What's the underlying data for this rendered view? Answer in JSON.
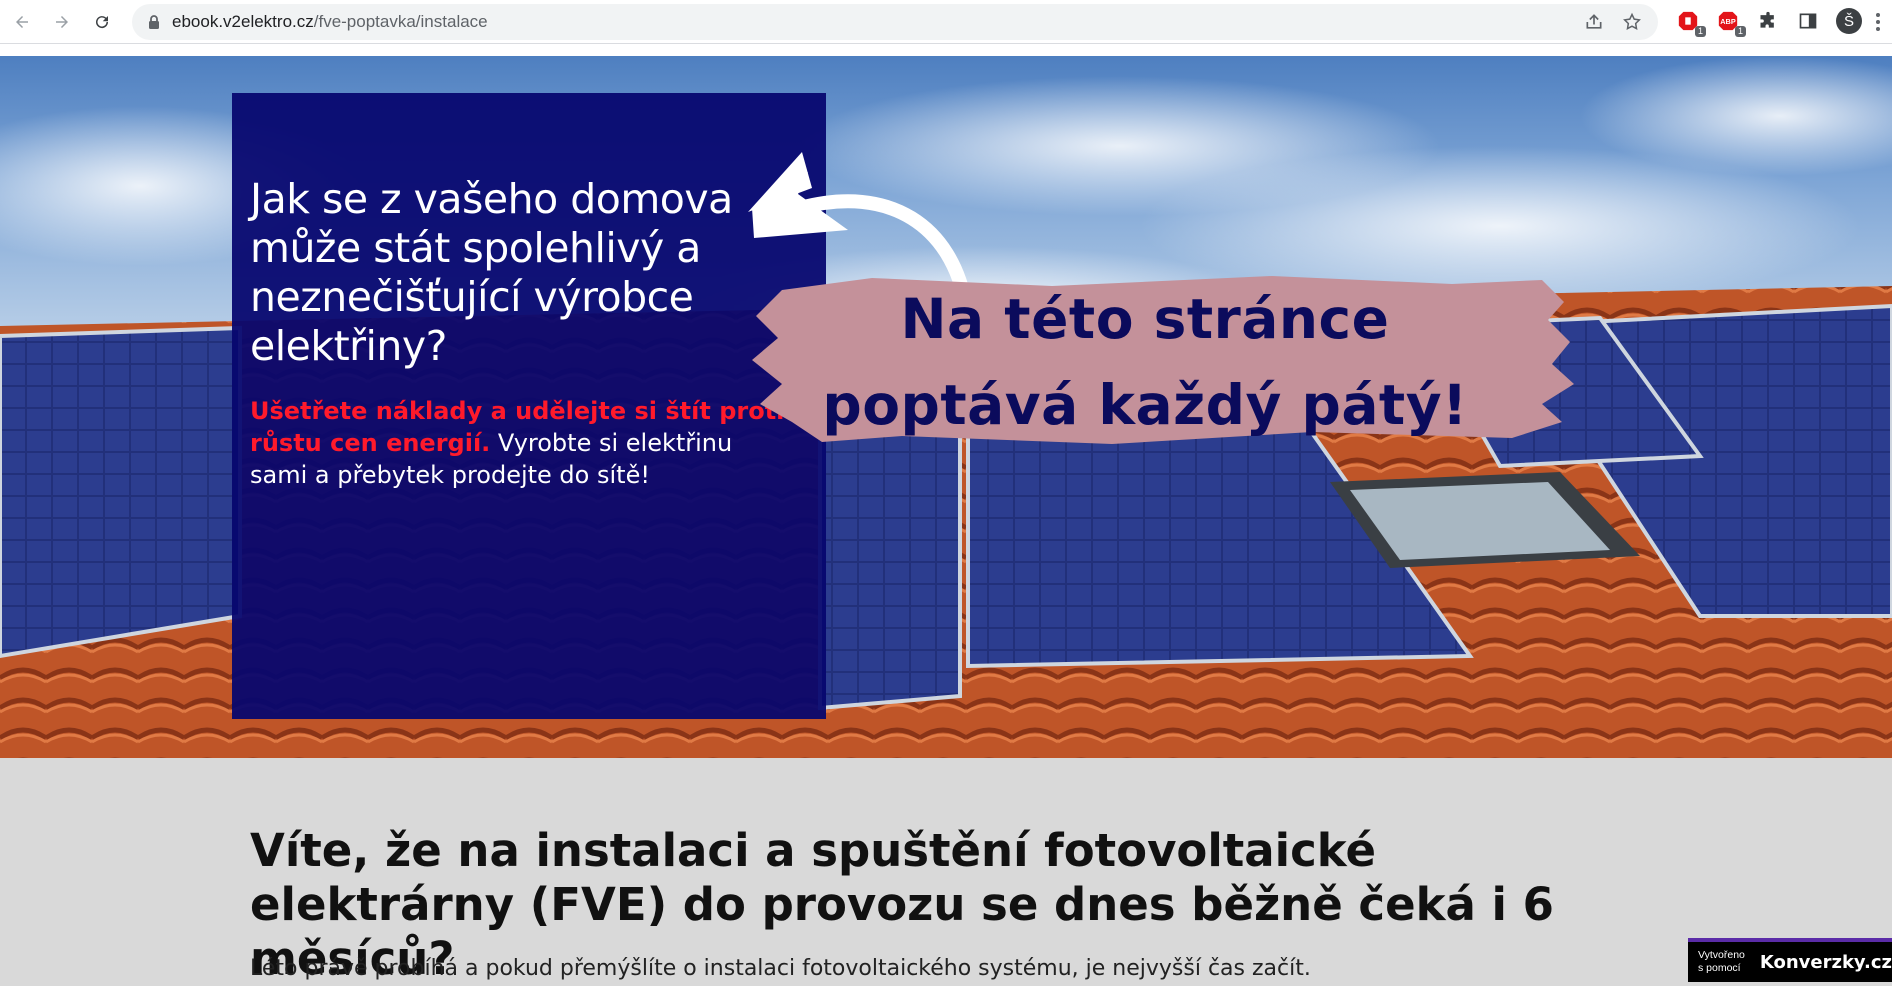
{
  "browser": {
    "url_host": "ebook.v2elektro.cz",
    "url_path": "/fve-poptavka/instalace",
    "extensions": [
      {
        "name": "adblock-icon",
        "badge": "1"
      },
      {
        "name": "abp-icon",
        "badge": "1",
        "label": "ABP"
      }
    ],
    "profile_initial": "Š"
  },
  "hero": {
    "title": "Jak se z vašeho domova může stát spolehlivý a neznečišťující výrobce elektřiny?",
    "text_highlight": "Ušetřete náklady a udělejte si štít proti růstu cen energií.",
    "text_rest": " Vyrobte si elektřinu sami a přebytek prodejte do sítě!",
    "callout_line1": "Na této stránce",
    "callout_line2": "poptává každý pátý!"
  },
  "section": {
    "heading": "Víte, že na instalaci a spuštění fotovoltaické elektrárny (FVE) do provozu se dnes běžně čeká i 6 měsíců?",
    "paragraph": "Léto právě probíhá a pokud přemýšlíte o instalaci fotovoltaického systému, je nejvyšší čas začít."
  },
  "made_by": {
    "small": "Vytvořeno s pomocí",
    "brand": "Konverzky.cz"
  },
  "colors": {
    "hero_box": "#06066e",
    "highlight_red": "#ff1a2b",
    "callout_bg": "#c4919a",
    "callout_text": "#0b0b5c",
    "roof_tile": "#c65a2e",
    "panel": "#1f2e78"
  }
}
